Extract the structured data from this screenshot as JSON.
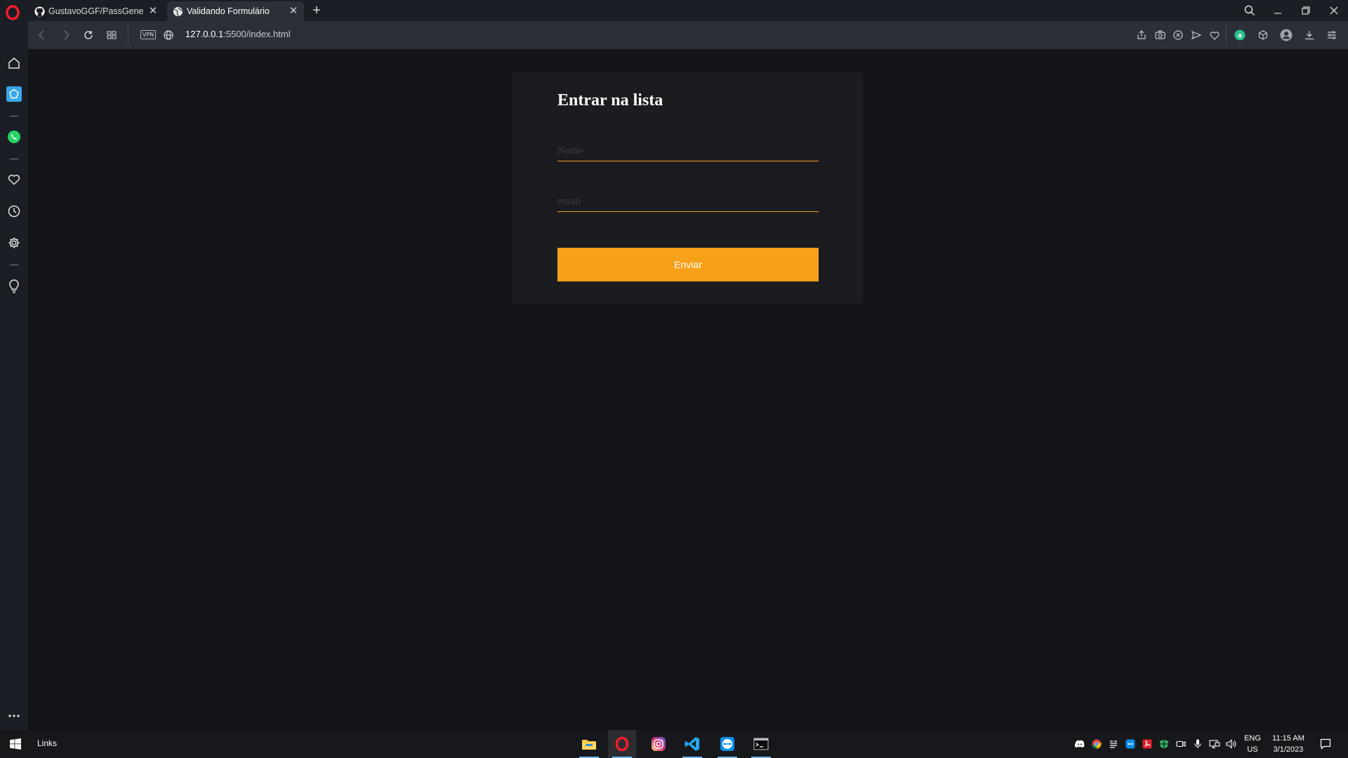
{
  "browser": {
    "tabs": [
      {
        "label": "GustavoGGF/PassGenerator",
        "favicon": "github-icon",
        "active": false
      },
      {
        "label": "Validando Formulário",
        "favicon": "globe-icon",
        "active": true
      }
    ],
    "address": {
      "host": "127.0.0.1",
      "path": ":5500/index.html",
      "vpn_label": "VPN"
    },
    "colors": {
      "titlebar": "#1b1e24",
      "toolbar": "#2b2f37",
      "opera_red": "#ff1b2d"
    }
  },
  "sidebar": {
    "items": [
      "home-icon",
      "speed-dial-icon",
      "whatsapp-icon",
      "heart-icon",
      "history-icon",
      "settings-icon",
      "lightbulb-icon",
      "more-icon"
    ]
  },
  "form": {
    "title": "Entrar na lista",
    "name_placeholder": "Nome",
    "email_placeholder": "email",
    "submit_label": "Enviar",
    "colors": {
      "accent": "#f7a01a",
      "card": "#1b1c1f",
      "page": "#131417"
    }
  },
  "taskbar": {
    "links_label": "Links",
    "apps": [
      "file-explorer-icon",
      "opera-icon",
      "instagram-icon",
      "vscode-icon",
      "teamviewer-icon",
      "terminal-icon"
    ],
    "lang_line1": "ENG",
    "lang_line2": "US",
    "time": "11:15 AM",
    "date": "3/1/2023"
  }
}
